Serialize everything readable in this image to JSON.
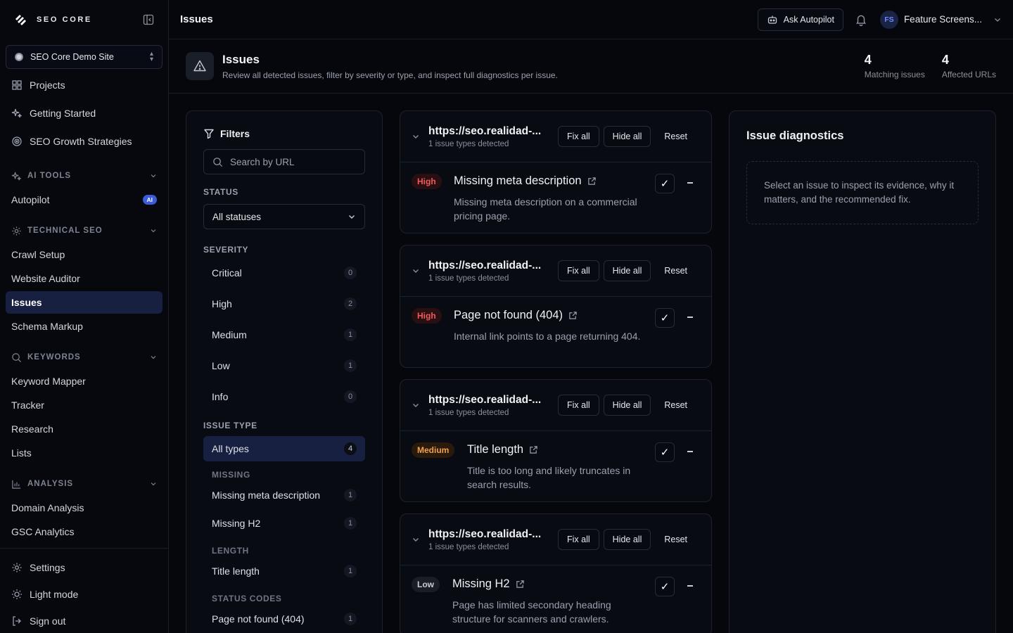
{
  "brand": {
    "name": "SEO CORE"
  },
  "site_selector": {
    "label": "SEO Core Demo Site"
  },
  "nav": {
    "top": [
      "Projects",
      "Getting Started",
      "SEO Growth Strategies"
    ],
    "ai_tools": {
      "label": "AI TOOLS",
      "items": [
        {
          "label": "Autopilot",
          "badge": "AI"
        }
      ]
    },
    "technical_seo": {
      "label": "TECHNICAL SEO",
      "items": [
        "Crawl Setup",
        "Website Auditor",
        "Issues",
        "Schema Markup"
      ]
    },
    "keywords": {
      "label": "KEYWORDS",
      "items": [
        "Keyword Mapper",
        "Tracker",
        "Research",
        "Lists"
      ]
    },
    "analysis": {
      "label": "ANALYSIS",
      "items": [
        "Domain Analysis",
        "GSC Analytics"
      ]
    },
    "bottom": [
      "Settings",
      "Light mode",
      "Sign out"
    ]
  },
  "topbar": {
    "title": "Issues",
    "ask_label": "Ask Autopilot",
    "user_initials": "FS",
    "user_name": "Feature Screens..."
  },
  "page_header": {
    "title": "Issues",
    "description": "Review all detected issues, filter by severity or type, and inspect full diagnostics per issue.",
    "stats": [
      {
        "value": "4",
        "label": "Matching issues"
      },
      {
        "value": "4",
        "label": "Affected URLs"
      }
    ]
  },
  "filters": {
    "title": "Filters",
    "search_placeholder": "Search by URL",
    "status_label": "STATUS",
    "status_value": "All statuses",
    "severity_label": "SEVERITY",
    "severity": [
      {
        "label": "Critical",
        "count": "0"
      },
      {
        "label": "High",
        "count": "2"
      },
      {
        "label": "Medium",
        "count": "1"
      },
      {
        "label": "Low",
        "count": "1"
      },
      {
        "label": "Info",
        "count": "0"
      }
    ],
    "issue_type_label": "ISSUE TYPE",
    "all_types": {
      "label": "All types",
      "count": "4"
    },
    "groups": [
      {
        "label": "MISSING",
        "items": [
          {
            "label": "Missing meta description",
            "count": "1"
          },
          {
            "label": "Missing H2",
            "count": "1"
          }
        ]
      },
      {
        "label": "LENGTH",
        "items": [
          {
            "label": "Title length",
            "count": "1"
          }
        ]
      },
      {
        "label": "STATUS CODES",
        "items": [
          {
            "label": "Page not found (404)",
            "count": "1"
          }
        ]
      }
    ]
  },
  "issues": {
    "buttons": {
      "fix_all": "Fix all",
      "hide_all": "Hide all",
      "reset": "Reset"
    },
    "cards": [
      {
        "url": "https://seo.realidad-...",
        "count": "1 issue types detected",
        "severity": "High",
        "title": "Missing meta description",
        "desc": "Missing meta description on a commercial pricing page."
      },
      {
        "url": "https://seo.realidad-...",
        "count": "1 issue types detected",
        "severity": "High",
        "title": "Page not found (404)",
        "desc": "Internal link points to a page returning 404."
      },
      {
        "url": "https://seo.realidad-...",
        "count": "1 issue types detected",
        "severity": "Medium",
        "title": "Title length",
        "desc": "Title is too long and likely truncates in search results."
      },
      {
        "url": "https://seo.realidad-...",
        "count": "1 issue types detected",
        "severity": "Low",
        "title": "Missing H2",
        "desc": "Page has limited secondary heading structure for scanners and crawlers."
      }
    ]
  },
  "diagnostics": {
    "title": "Issue diagnostics",
    "empty": "Select an issue to inspect its evidence, why it matters, and the recommended fix."
  },
  "colors": {
    "accent": "#3b5bdb",
    "active_bg": "#172040",
    "high": "#f05a5a",
    "medium": "#f0a050"
  }
}
